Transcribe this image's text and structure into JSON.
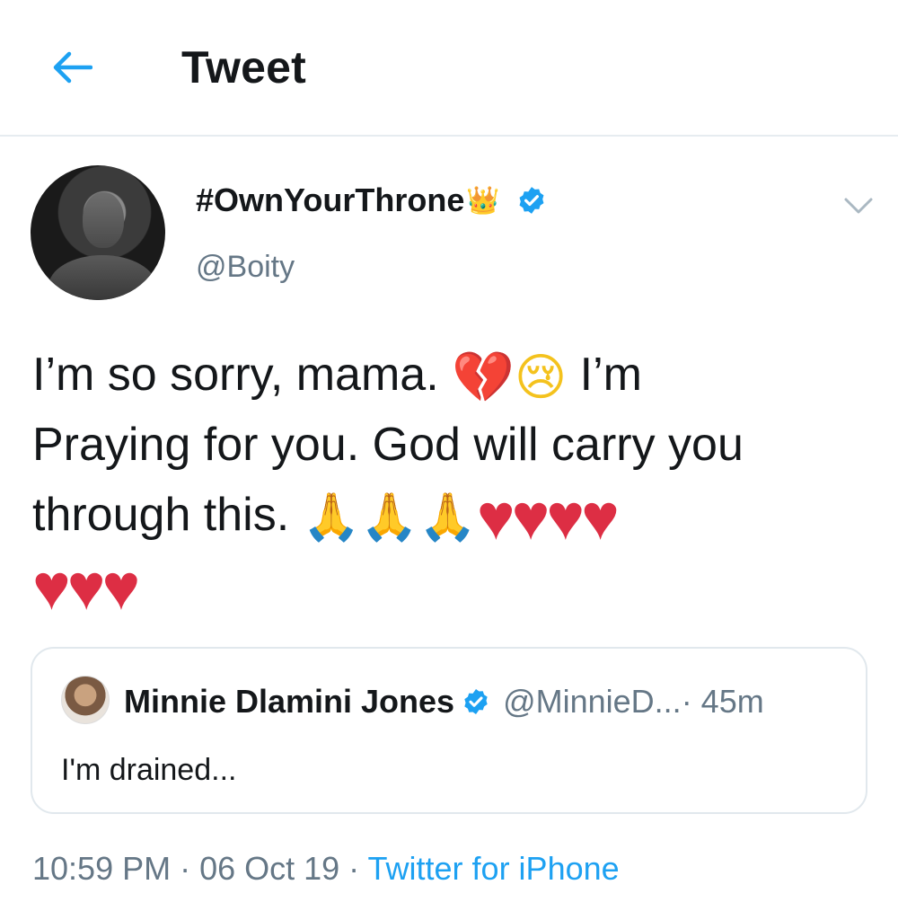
{
  "header": {
    "title": "Tweet"
  },
  "tweet": {
    "display_name": "#OwnYourThrone",
    "handle": "@Boity",
    "text_line1": "I’m so sorry, mama.",
    "text_line1_end": "I’m",
    "text_line2": "Praying for you. God will carry you",
    "text_line3": "through this.",
    "timestamp": "10:59 PM · 06 Oct 19 · ",
    "source": "Twitter for iPhone",
    "emoji": {
      "broken_heart": "💔",
      "crying_face": "😢",
      "folded_hands": "🙏",
      "red_heart": "♥",
      "crown": "👑"
    }
  },
  "quoted": {
    "name": "Minnie Dlamini Jones",
    "handle": "@MinnieD...",
    "time": " · 45m",
    "text": "I'm drained..."
  },
  "colors": {
    "accent": "#1da1f2",
    "secondary_text": "#657786",
    "heart": "#dd2e44"
  }
}
